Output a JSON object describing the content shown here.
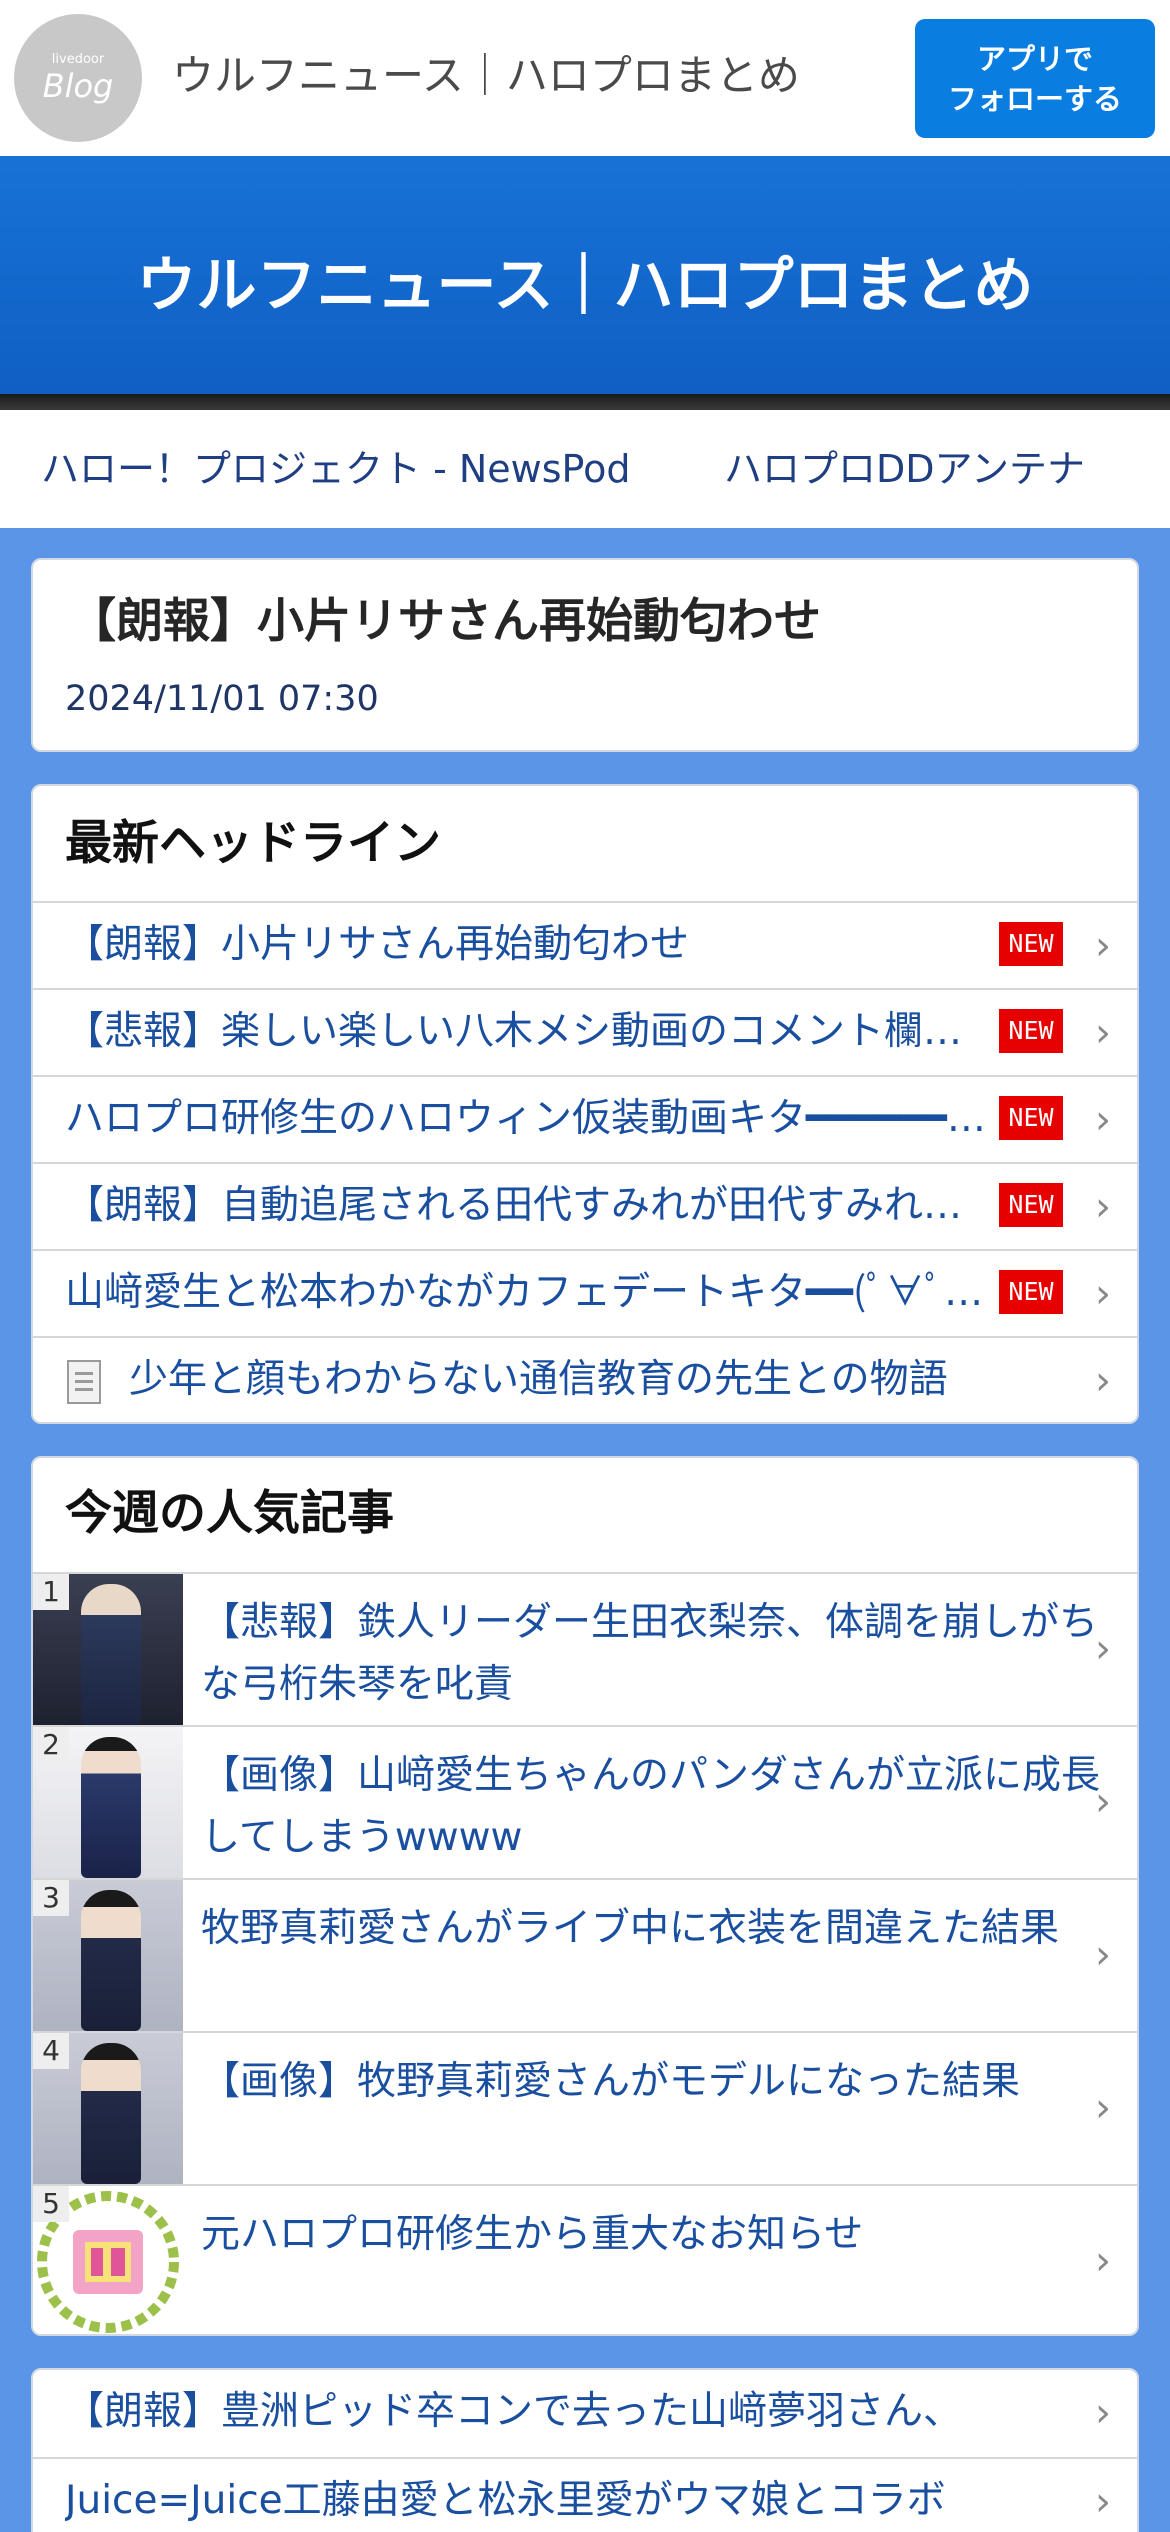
{
  "topbar": {
    "logo_small": "livedoor",
    "logo_big": "Blog",
    "site_name": "ウルフニュース｜ハロプロまとめ",
    "follow_line1": "アプリで",
    "follow_line2": "フォローする"
  },
  "banner": {
    "title": "ウルフニュース｜ハロプロまとめ"
  },
  "links": [
    {
      "label": "ハロー！プロジェクト - NewsPod"
    },
    {
      "label": "ハロプロDDアンテナ"
    }
  ],
  "article": {
    "headline": "【朗報】小片リサさん再始動匂わせ",
    "date": "2024/11/01 07:30"
  },
  "headlines": {
    "title": "最新ヘッドライン",
    "items": [
      {
        "text": "【朗報】小片リサさん再始動匂わせ",
        "badge": "NEW"
      },
      {
        "text": "【悲報】楽しい楽しい八木メシ動画のコメント欄が荒れてる",
        "badge": "NEW"
      },
      {
        "text": "ハロプロ研修生のハロウィン仮装動画キタ━━━━━━(ﾟ∀ﾟ)━━━━━━!!",
        "badge": "NEW"
      },
      {
        "text": "【朗報】自動追尾される田代すみれが田代すみれすぎる",
        "badge": "NEW"
      },
      {
        "text": "山﨑愛生と松本わかながカフェデートキタ━━(ﾟ∀ﾟ)━━!!",
        "badge": "NEW"
      },
      {
        "text": "少年と顔もわからない通信教育の先生との物語",
        "badge": ""
      }
    ]
  },
  "popular": {
    "title": "今週の人気記事",
    "items": [
      {
        "rank": "1",
        "text": "【悲報】鉄人リーダー生田衣梨奈、体調を崩しがちな弓桁朱琴を叱責"
      },
      {
        "rank": "2",
        "text": "【画像】山﨑愛生ちゃんのパンダさんが立派に成長してしまうwwww"
      },
      {
        "rank": "3",
        "text": "牧野真莉愛さんがライブ中に衣装を間違えた結果"
      },
      {
        "rank": "4",
        "text": "【画像】牧野真莉愛さんがモデルになった結果"
      },
      {
        "rank": "5",
        "text": "元ハロプロ研修生から重大なお知らせ"
      }
    ]
  },
  "more": {
    "items": [
      {
        "text": "【朗報】豊洲ピッド卒コンで去った山﨑夢羽さん、"
      },
      {
        "text": "Juice=Juice工藤由愛と松永里愛がウマ娘とコラボ"
      }
    ]
  },
  "icons": {
    "chevron": "chevron-right-icon",
    "document": "document-icon"
  },
  "colors": {
    "background": "#5b95e8",
    "banner": "#1872d6",
    "follow_button": "#0a7de0",
    "new_badge": "#e60000",
    "link_text": "#1a4fa0"
  }
}
